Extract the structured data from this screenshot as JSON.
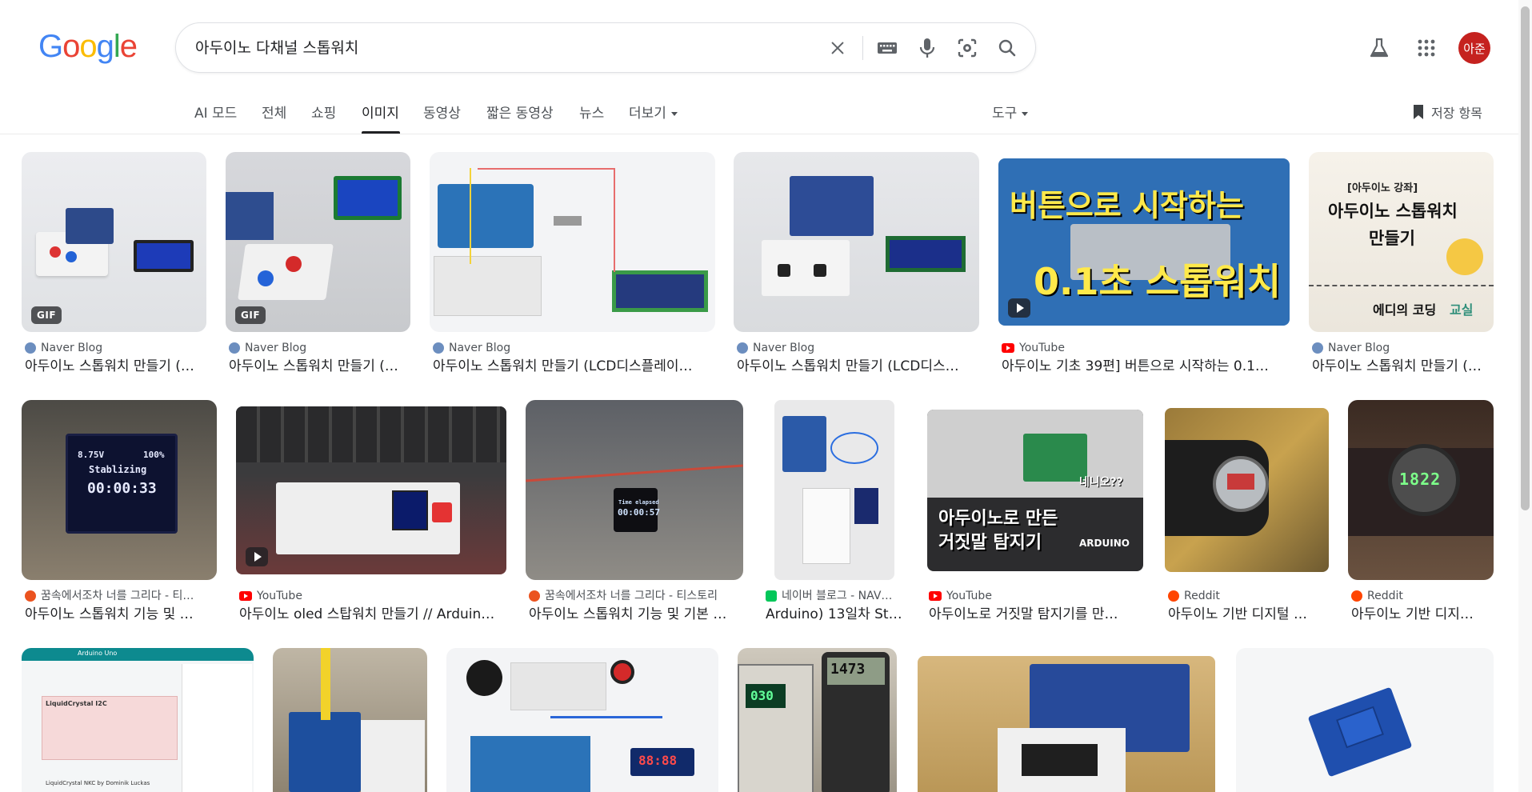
{
  "search": {
    "query": "아두이노 다채널 스톱워치",
    "logo_letters": [
      "G",
      "o",
      "o",
      "g",
      "l",
      "e"
    ]
  },
  "header": {
    "avatar_text": "아준"
  },
  "tabs": [
    {
      "label": "AI 모드"
    },
    {
      "label": "전체"
    },
    {
      "label": "쇼핑"
    },
    {
      "label": "이미지"
    },
    {
      "label": "동영상"
    },
    {
      "label": "짧은 동영상"
    },
    {
      "label": "뉴스"
    },
    {
      "label": "더보기"
    }
  ],
  "tools_label": "도구",
  "saved_label": "저장 항목",
  "results": [
    {
      "source": "Naver Blog",
      "title": "아두이노 스톱워치 만들기 (…",
      "badge": "GIF"
    },
    {
      "source": "Naver Blog",
      "title": "아두이노 스톱워치 만들기 (…",
      "badge": "GIF"
    },
    {
      "source": "Naver Blog",
      "title": "아두이노 스톱워치 만들기 (LCD디스플레이…"
    },
    {
      "source": "Naver Blog",
      "title": "아두이노 스톱워치 만들기 (LCD디스…"
    },
    {
      "source": "YouTube",
      "title": "아두이노 기초 39편] 버튼으로 시작하는 0.1…",
      "overlay1": "버튼으로 시작하는",
      "overlay2": "0.1초 스톱워치"
    },
    {
      "source": "Naver Blog",
      "title": "아두이노 스톱워치 만들기 (…",
      "overlay1": "[아두이노 강좌]",
      "overlay2": "아두이노 스톱워치",
      "overlay3": "만들기",
      "overlay4": "에디의 코딩",
      "overlay5": "교실"
    },
    {
      "source": "꿈속에서조차 너를 그리다 - 티…",
      "title": "아두이노 스톱워치 기능 및 …",
      "screen1": "8.75V",
      "screen2": "100%",
      "screen3": "Stablizing",
      "screen4": "00:00:33"
    },
    {
      "source": "YouTube",
      "title": "아두이노 oled 스탑워치 만들기 // Arduin…"
    },
    {
      "source": "꿈속에서조차 너를 그리다 - 티스토리",
      "title": "아두이노 스톱워치 기능 및 기본 …",
      "screen1": "Time elapsed",
      "screen2": "00:00:57"
    },
    {
      "source": "네이버 블로그 - NAV…",
      "title": "Arduino) 13일차 St…"
    },
    {
      "source": "YouTube",
      "title": "아두이노로 거짓말 탐지기를 만…",
      "overlay1": "아두이노로 만든",
      "overlay2": "거짓말 탐지기",
      "overlay3": "네니오??",
      "overlay4": "ARDUINO"
    },
    {
      "source": "Reddit",
      "title": "아두이노 기반 디지털 …"
    },
    {
      "source": "Reddit",
      "title": "아두이노 기반 디지…",
      "screen1": "1822"
    },
    {
      "screen1": "Arduino Uno",
      "screen2": "LiquidCrystal I2C",
      "screen3": "LiquidCrystal NKC by Dominik Luckas"
    },
    {},
    {
      "screen1": "88:88"
    },
    {
      "screen1": "030",
      "screen2": "1473"
    },
    {},
    {}
  ],
  "colors": {
    "blue": "#4285f4",
    "red": "#ea4335",
    "yellow": "#fbbc05",
    "green": "#34a853",
    "youtube": "#ff0000",
    "naver": "#6c8ebf",
    "reddit": "#ff4500",
    "tistory": "#eb531f",
    "naver_green": "#03c75a"
  },
  "icons": [
    "clear-icon",
    "keyboard-icon",
    "mic-icon",
    "lens-icon",
    "search-icon",
    "labs-icon",
    "apps-icon",
    "bookmark-icon"
  ]
}
